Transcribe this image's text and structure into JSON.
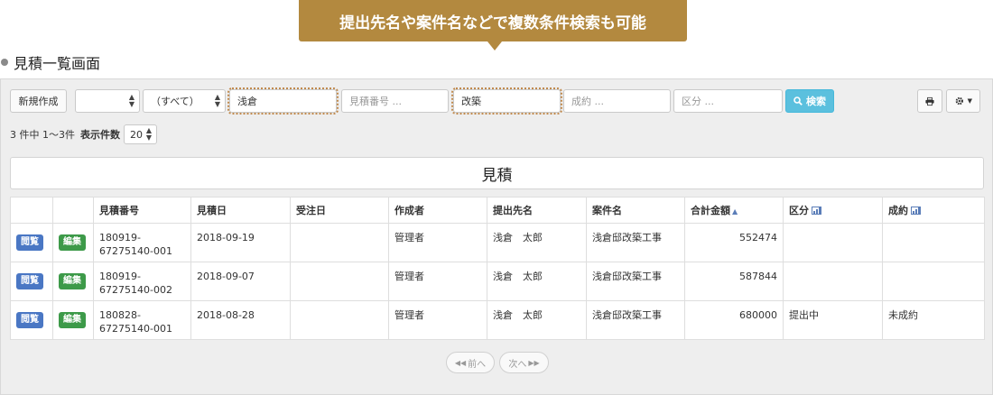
{
  "callout": {
    "text": "提出先名や案件名などで複数条件検索も可能"
  },
  "section_heading": "見積一覧画面",
  "toolbar": {
    "new_button": "新規作成",
    "select1_value": "",
    "select2_value": "（すべて）",
    "field_address": "浅倉",
    "field_estimate_no_placeholder": "見積番号 ...",
    "field_project": "改築",
    "field_contract_placeholder": "成約 ...",
    "field_category_placeholder": "区分 ...",
    "search_button": "検索",
    "search_icon": "search-icon",
    "print_icon": "print-icon",
    "settings_icon": "gear-icon"
  },
  "count": {
    "summary": "3 件中 1〜3件",
    "per_page_label": "表示件数",
    "per_page_value": "20"
  },
  "panel_title": "見積",
  "table": {
    "headers": [
      "",
      "",
      "見積番号",
      "見積日",
      "受注日",
      "作成者",
      "提出先名",
      "案件名",
      "合計金額",
      "区分",
      "成約"
    ],
    "view_label": "閲覧",
    "edit_label": "編集",
    "rows": [
      {
        "estimate_no": "180919-67275140-001",
        "estimate_date": "2018-09-19",
        "order_date": "",
        "creator": "管理者",
        "recipient": "浅倉　太郎",
        "project": "浅倉邸改築工事",
        "total": "552474",
        "category": "",
        "contract": ""
      },
      {
        "estimate_no": "180919-67275140-002",
        "estimate_date": "2018-09-07",
        "order_date": "",
        "creator": "管理者",
        "recipient": "浅倉　太郎",
        "project": "浅倉邸改築工事",
        "total": "587844",
        "category": "",
        "contract": ""
      },
      {
        "estimate_no": "180828-67275140-001",
        "estimate_date": "2018-08-28",
        "order_date": "",
        "creator": "管理者",
        "recipient": "浅倉　太郎",
        "project": "浅倉邸改築工事",
        "total": "680000",
        "category": "提出中",
        "contract": "未成約"
      }
    ]
  },
  "pagination": {
    "prev": "前へ",
    "next": "次へ"
  },
  "colors": {
    "callout": "#b3893f",
    "search_button": "#5bc0de",
    "view_badge": "#4a77c4",
    "edit_badge": "#3d9a49"
  }
}
